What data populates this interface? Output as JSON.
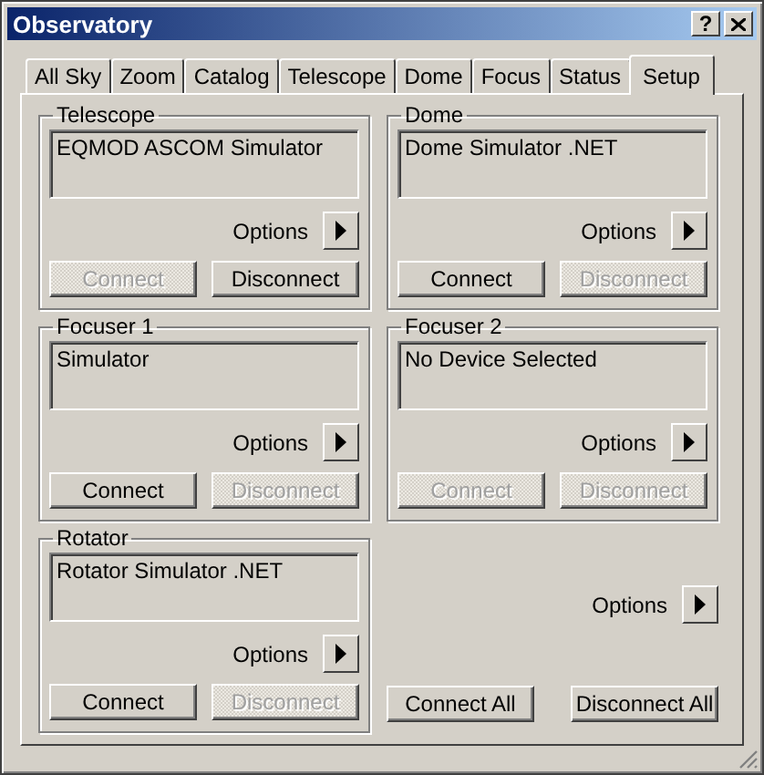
{
  "window": {
    "title": "Observatory",
    "help_button": "?"
  },
  "tabs": [
    {
      "label": "All Sky",
      "selected": false
    },
    {
      "label": "Zoom",
      "selected": false
    },
    {
      "label": "Catalog",
      "selected": false
    },
    {
      "label": "Telescope",
      "selected": false
    },
    {
      "label": "Dome",
      "selected": false
    },
    {
      "label": "Focus",
      "selected": false
    },
    {
      "label": "Status",
      "selected": false
    },
    {
      "label": "Setup",
      "selected": true
    }
  ],
  "devices": [
    {
      "label": "Telescope",
      "device": "EQMOD ASCOM Simulator",
      "options": "Options",
      "connect": {
        "label": "Connect",
        "disabled": true
      },
      "disconnect": {
        "label": "Disconnect",
        "disabled": false
      }
    },
    {
      "label": "Dome",
      "device": "Dome Simulator .NET",
      "options": "Options",
      "connect": {
        "label": "Connect",
        "disabled": false
      },
      "disconnect": {
        "label": "Disconnect",
        "disabled": true
      }
    },
    {
      "label": "Focuser 1",
      "device": "Simulator",
      "options": "Options",
      "connect": {
        "label": "Connect",
        "disabled": false
      },
      "disconnect": {
        "label": "Disconnect",
        "disabled": true
      }
    },
    {
      "label": "Focuser 2",
      "device": "No Device Selected",
      "options": "Options",
      "connect": {
        "label": "Connect",
        "disabled": true
      },
      "disconnect": {
        "label": "Disconnect",
        "disabled": true
      }
    },
    {
      "label": "Rotator",
      "device": "Rotator Simulator .NET",
      "options": "Options",
      "connect": {
        "label": "Connect",
        "disabled": false
      },
      "disconnect": {
        "label": "Disconnect",
        "disabled": true
      }
    }
  ],
  "all_devices": {
    "options": "Options",
    "connect_all": "Connect All",
    "disconnect_all": "Disconnect All"
  }
}
